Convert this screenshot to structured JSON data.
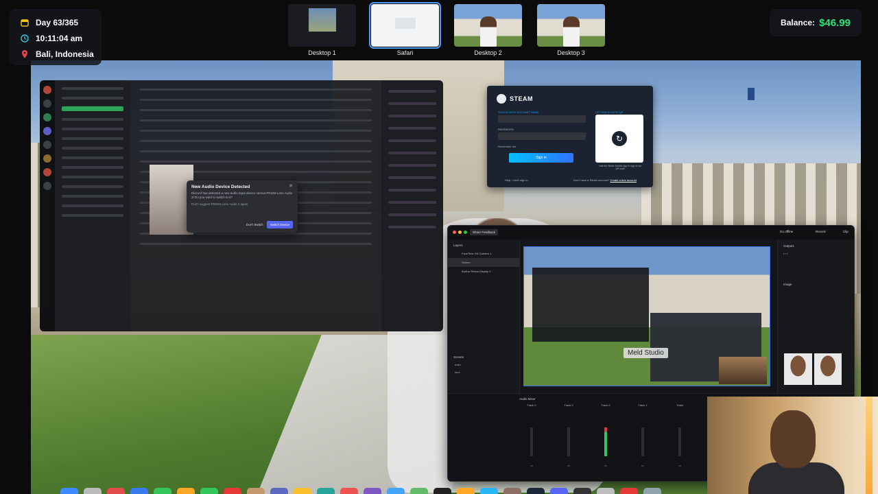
{
  "hud": {
    "day": "Day 63/365",
    "time": "10:11:04 am",
    "location": "Bali, Indonesia",
    "balance_label": "Balance:",
    "balance_value": "$46.99"
  },
  "spaces": [
    {
      "label": "Desktop 1"
    },
    {
      "label": "Safari"
    },
    {
      "label": "Desktop 2"
    },
    {
      "label": "Desktop 3"
    }
  ],
  "discord_dialog": {
    "title": "New Audio Device Detected",
    "body": "Discord has detected a new audio input device named PRISM Lens Audio 3! Do you want to switch to it?",
    "checkbox": "Don't suggest PRISM Lens Audio 3 again",
    "secondary": "Don't Switch",
    "primary": "Switch Device"
  },
  "steam": {
    "logo": "STEAM",
    "signin_label": "SIGN IN WITH ACCOUNT NAME",
    "password_label": "PASSWORD",
    "remember": "Remember me",
    "signin_button": "Sign in",
    "help": "Help, I can't sign in",
    "qr_label": "OR SIGN IN WITH QR",
    "qr_hint": "Use the Steam Mobile App to sign in via QR code",
    "create_prefix": "Don't have a Steam account?",
    "create_link": "Create a free account"
  },
  "meld": {
    "feedback": "Share Feedback",
    "go_offline": "Go offline",
    "record": "Record",
    "clip": "Clip",
    "layers_title": "Layers",
    "layers": [
      "FaceTime HD Camera 1",
      "Screen",
      "Built-in Retina Display 0"
    ],
    "scenes_title": "Scenes",
    "scenes": [
      "main",
      "face"
    ],
    "overlay_tag": "Meld Studio",
    "outputs_title": "Outputs",
    "image_title": "Image",
    "mixer_title": "Audio Mixer",
    "tracks": [
      "Track 0",
      "Track 0",
      "Track 0",
      "Track 1",
      "Track"
    ]
  },
  "colors": {
    "balance_green": "#2ee37a",
    "hud_bg": "#15161c",
    "accent_blue": "#4c9bff",
    "discord_blurple": "#5865f2",
    "steam_blue": "#1a9fff"
  }
}
